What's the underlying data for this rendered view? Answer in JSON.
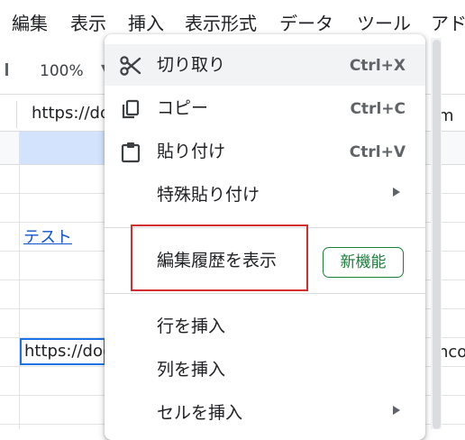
{
  "menubar": {
    "items": [
      "編集",
      "表示",
      "挿入",
      "表示形式",
      "データ",
      "ツール",
      "アド"
    ]
  },
  "toolbar": {
    "zoom": "100%"
  },
  "formula_bar": {
    "value": "https://do"
  },
  "sheet": {
    "link_cell": "テスト",
    "active_cell": "https://doc",
    "right_fragments": [
      "m",
      "nco"
    ]
  },
  "context_menu": {
    "items": [
      {
        "icon": "scissors-icon",
        "label": "切り取り",
        "shortcut": "Ctrl+X"
      },
      {
        "icon": "copy-icon",
        "label": "コピー",
        "shortcut": "Ctrl+C"
      },
      {
        "icon": "clipboard-icon",
        "label": "貼り付け",
        "shortcut": "Ctrl+V"
      },
      {
        "label": "特殊貼り付け",
        "submenu": true
      },
      {
        "label": "編集履歴を表示",
        "badge": "新機能"
      },
      {
        "label": "行を挿入"
      },
      {
        "label": "列を挿入"
      },
      {
        "label": "セルを挿入",
        "submenu": true
      }
    ]
  },
  "colors": {
    "highlight_box": "#d32f2f",
    "badge": "#188038",
    "link": "#1155cc",
    "selection": "#1a73e8"
  }
}
